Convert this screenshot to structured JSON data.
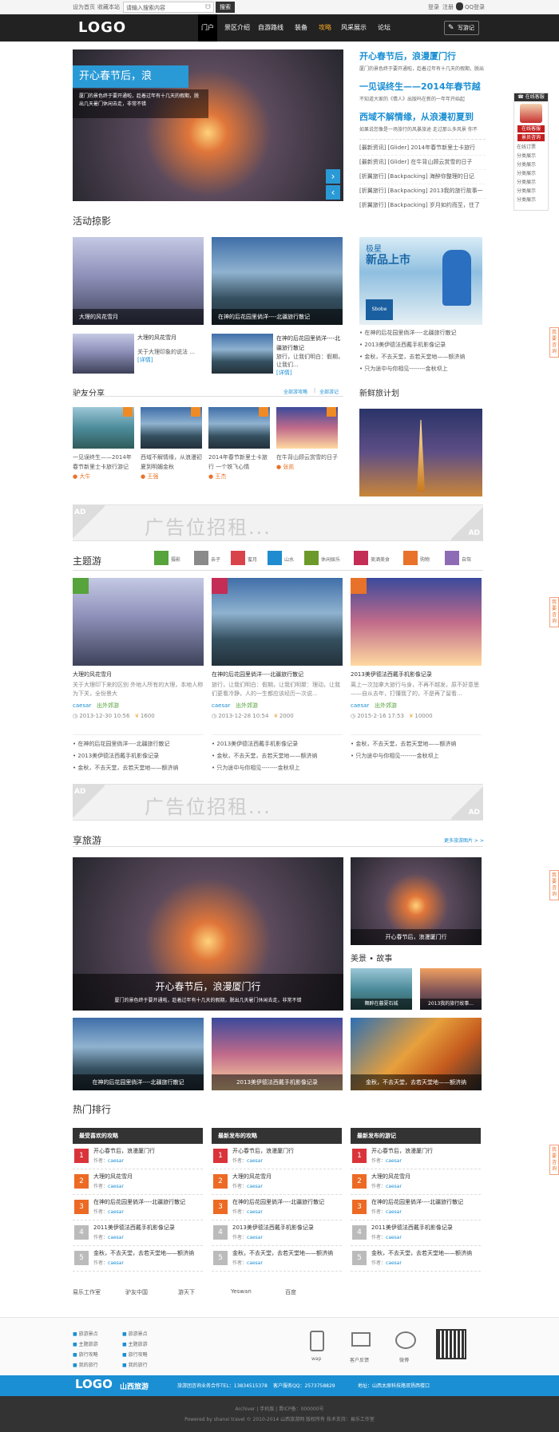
{
  "topbar": {
    "set_home": "设为首页",
    "add_fav": "收藏本站",
    "search_placeholder": "请输入搜索内容",
    "search_btn": "搜索",
    "login": "登录",
    "register": "注册",
    "qq_login": "QQ登录"
  },
  "nav": {
    "logo": "LOGO",
    "items": [
      "门户",
      "景区介绍",
      "自游路线",
      "装备",
      "攻略",
      "风采展示",
      "论坛"
    ],
    "write_btn": "写游记"
  },
  "hero": {
    "caption_title": "开心春节后，浪",
    "caption_text": "厦门的景色终于要开通啦，趁着过年有十几天的假期，脱出几天暑门休闲去走，非常不错",
    "headlines": [
      "开心春节后，浪漫厦门行",
      "一见误终生——2014年春节越",
      "西域不解情缘，从浪漫初夏到"
    ],
    "headline_subs": [
      "厦门的景色终于要开通啦，趁着过年有十几天的假期，脱出",
      "不知道大家的《情人》出版吗在新的一年年开始起",
      "如果说您像是一场旅行的风暴旅途 走过那么多风景 你不"
    ],
    "news": [
      "[最新资讯] [Glider] 2014年春节新里士卡旅行",
      "[最新资讯] [Glider] 在牛背山顾云赏雪的日子",
      "[折翼旅行] [Backpacking] 海醉你整理的日记",
      "[折翼旅行] [Backpacking] 2013我的旅行故事一",
      "[折翼旅行] [Backpacking] 岁月如约而至，住了"
    ]
  },
  "side_service": {
    "title": "在线客服",
    "online": "在线客服",
    "staff": "景员咨询",
    "items": [
      "在线订票",
      "分类展示",
      "分类展示",
      "分类展示",
      "分类展示",
      "分类展示",
      "分类展示"
    ]
  },
  "activity": {
    "title": "活动掠影",
    "big1": "大理的风花雪月",
    "big2": "在神的后花园里倘洋----北疆旅行散记",
    "small1_title": "大理的风花雪月",
    "small1_text": "关于大理印象的说法 ...",
    "small2_title": "在神的后花园里倘洋----北疆旅行散记",
    "small2_text": "旅行，让我们明白：假期，让我们...",
    "more": "[详情]",
    "ad_title": "极星",
    "ad_sub": "新品上市",
    "ad_brand": "Sbobe",
    "right_list": [
      "在神的后花园里倘洋----北疆旅行散记",
      "2013美伊德法西戴手机影像记录",
      "金秋，不去天堂，去若天堂地——额济纳",
      "只为途中与你相见--------金秋坝上"
    ]
  },
  "friends": {
    "title": "驴友分享",
    "link1": "全部游攻略",
    "link2": "全部游记",
    "items": [
      {
        "t": "一见误终生——2014年春节新里士卡旅行游记",
        "u": "大牛"
      },
      {
        "t": "西域不解情缘，从浪漫初夏到明媚金秋",
        "u": "王强"
      },
      {
        "t": "2014年春节新里士卡旅行 一个铁飞心情",
        "u": "王杰"
      },
      {
        "t": "在牛背山顾云赏雪的日子",
        "u": "张凯"
      }
    ],
    "new_plan": "新鲜旅计划"
  },
  "ad": {
    "text": "广告位招租...",
    "mark": "AD"
  },
  "theme": {
    "title": "主题游",
    "cats": [
      "摄影",
      "亲子",
      "蜜月",
      "山水",
      "休闲娱乐",
      "美酒美食",
      "购物",
      "自驾"
    ],
    "cards": [
      {
        "title": "大理的风花雪月",
        "text": "关于大理印下来的区别 外地人所有的大理，本地人称为下关，全份景大",
        "user": "caesar",
        "tag": "出外郊游",
        "time": "2013-12-30 10:56",
        "views": "1600"
      },
      {
        "title": "在神的后花园里倘洋----北疆旅行散记",
        "text": "旅行，让我们明白：假期，让我们明聚：理动，让我们更看冷静，人的一生都应该经历一次说...",
        "user": "caesar",
        "tag": "出外郊游",
        "time": "2013-12-28 10:54",
        "views": "2000"
      },
      {
        "title": "2013美伊德法西戴手机影像记录",
        "text": "离上一次加拿大旅行与身，不再不越发，原不好意思——自从去年，打懂我了的，不是再了留看...",
        "user": "caesar",
        "tag": "出外郊游",
        "time": "2015-2-16 17:53",
        "views": "10000"
      }
    ],
    "lists": [
      [
        "在神的后花园里倘洋----北疆旅行散记",
        "2013美伊德法西戴手机影像记录",
        "金秋，不去天堂，去若天堂地——额济纳"
      ],
      [
        "2013美伊德法西戴手机影像记录",
        "金秋，不去天堂，去若天堂地——额济纳",
        "只为途中与你相见--------金秋坝上"
      ],
      [
        "金秋，不去天堂，去若天堂地——额济纳",
        "只为途中与你相见--------金秋坝上"
      ]
    ]
  },
  "enjoy": {
    "title": "享旅游",
    "more": "更多旅游图片 > >",
    "big_title": "开心春节后，浪漫厦门行",
    "big_text": "厦门的景色终于要开通啦，趁着过年有十几天的假期，脱出几天暑门休闲去走，非常不错",
    "side_cap": "开心春节后，浪漫厦门行",
    "story_title": "美景 • 故事",
    "story1": "舞醉在暮夏石城",
    "story2": "2013我的旅行故事...",
    "row": [
      "在神的后花园里倘洋----北疆旅行散记",
      "2013美伊德法西戴手机影像记录",
      "金秋，不去天堂，去若天堂地——额济纳"
    ]
  },
  "rank": {
    "title": "热门排行",
    "cols": [
      {
        "head": "最受喜欢的攻略",
        "rows": [
          "开心春节后，浪漫厦门行",
          "大理的风花雪月",
          "在神的后花园里倘洋----北疆旅行散记",
          "2011美伊德法西戴手机影像记录",
          "金秋，不去天堂，去若天堂地——额济纳"
        ]
      },
      {
        "head": "最新发布的攻略",
        "rows": [
          "开心春节后，浪漫厦门行",
          "大理的风花雪月",
          "在神的后花园里倘洋----北疆旅行散记",
          "2013美伊德法西戴手机影像记录",
          "金秋，不去天堂，去若天堂地——额济纳"
        ]
      },
      {
        "head": "最新发布的游记",
        "rows": [
          "开心春节后，浪漫厦门行",
          "大理的风花雪月",
          "在神的后花园里倘洋----北疆旅行散记",
          "2011美伊德法西戴手机影像记录",
          "金秋，不去天堂，去若天堂地——额济纳"
        ]
      }
    ],
    "author_label": "作者：",
    "author": "caesar"
  },
  "links": [
    "易乐工作室",
    "驴友中国",
    "游天下",
    "Yeswan",
    "百度"
  ],
  "footer": {
    "col1": [
      "旅游景点",
      "主题旅游",
      "旅行攻略",
      "我的旅行"
    ],
    "col2": [
      "旅游景点",
      "主题旅游",
      "旅行攻略",
      "我的旅行"
    ],
    "icons": [
      "wap",
      "客户反馈",
      "微博"
    ],
    "logo": "LOGO",
    "logo_cn": "山西旅游",
    "hotline": "旅游团咨询业务合作TEL：13834515378",
    "qq": "客户服务QQ：2573758829",
    "address": "地址：山西太原科技路双扬西楼口",
    "bottom1": "Archiver | 手机版 | 晋ICP备：000000号",
    "bottom2": "Powered by shanxi travel © 2010-2014 山西旅游网 版权所有  技术支持：易乐工作室"
  },
  "float_tab": "我要咨询"
}
